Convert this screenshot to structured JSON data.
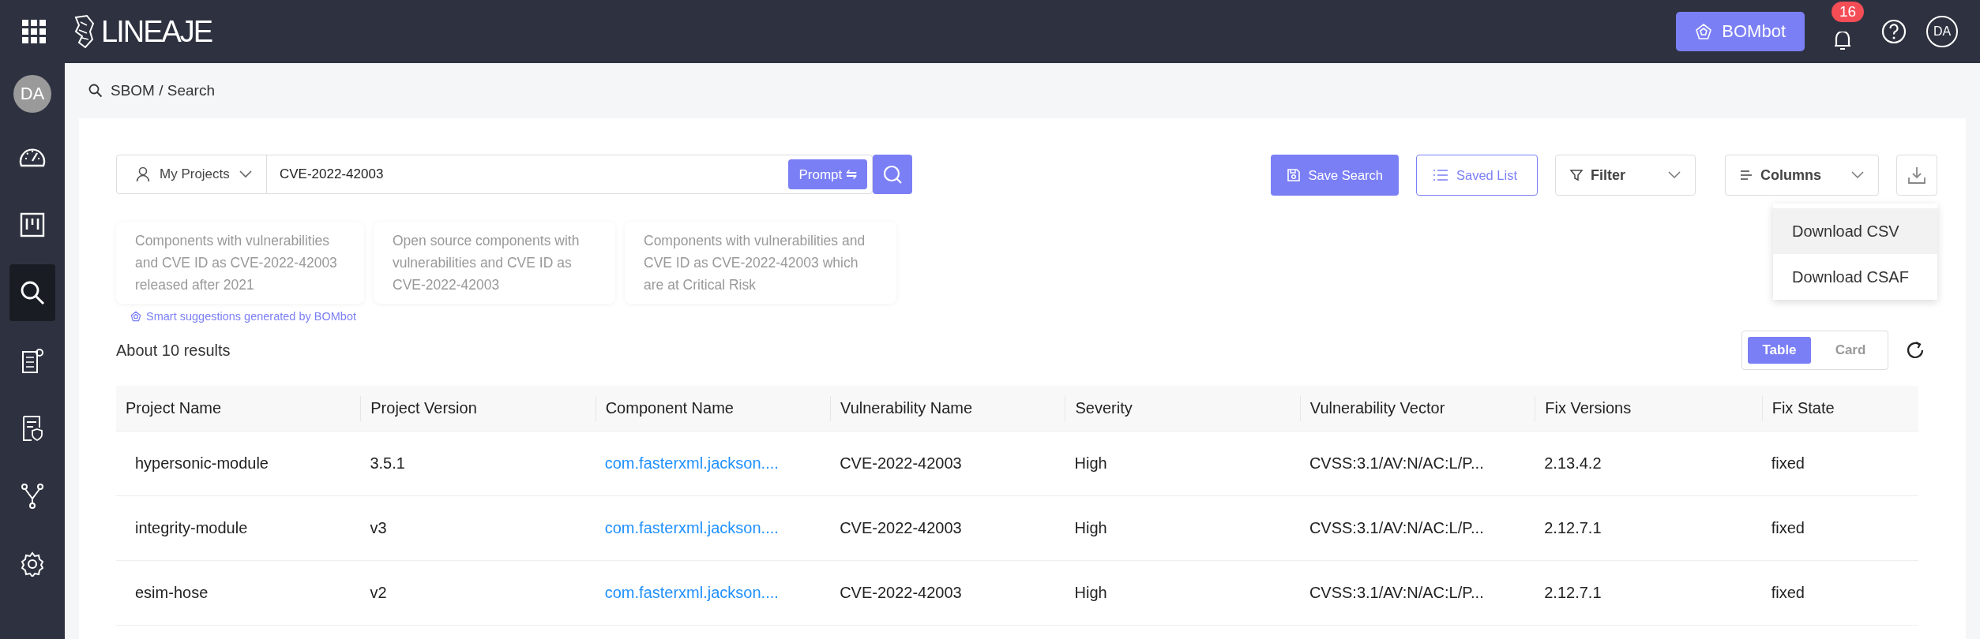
{
  "top_bar": {
    "logo": "LINEAJE",
    "bombot_button": "BOMbot",
    "notification_count": "16",
    "user_initials": "DA"
  },
  "sidebar": {
    "user_initials": "DA",
    "items": [
      {
        "kind": "dashboard",
        "selected": false
      },
      {
        "kind": "board",
        "selected": false
      },
      {
        "kind": "search",
        "selected": true
      },
      {
        "kind": "document",
        "selected": false
      },
      {
        "kind": "policy",
        "selected": false
      },
      {
        "kind": "branch",
        "selected": false
      },
      {
        "kind": "settings",
        "selected": false
      }
    ]
  },
  "breadcrumb": "SBOM / Search",
  "search": {
    "scope": "My Projects",
    "value": "CVE-2022-42003",
    "prompt_button": "Prompt ⇋"
  },
  "suggestions": [
    "Components with vulnerabilities and CVE ID as CVE-2022-42003 released after 2021",
    "Open source components with vulnerabilities and CVE ID as CVE-2022-42003",
    "Components with vulnerabilities and CVE ID as CVE-2022-42003 which are at Critical Risk"
  ],
  "suggestions_note": "Smart suggestions generated by BOMbot",
  "toolbar": {
    "save_search": "Save Search",
    "saved_list": "Saved List",
    "filter": "Filter",
    "columns": "Columns"
  },
  "download_menu": [
    {
      "label": "Download CSV",
      "highlighted": true
    },
    {
      "label": "Download CSAF",
      "highlighted": false
    }
  ],
  "results_count": "About 10 results",
  "view_toggle": [
    {
      "label": "Table",
      "selected": true
    },
    {
      "label": "Card",
      "selected": false
    }
  ],
  "table": {
    "columns": [
      "Project Name",
      "Project Version",
      "Component Name",
      "Vulnerability Name",
      "Severity",
      "Vulnerability Vector",
      "Fix Versions",
      "Fix State"
    ],
    "rows": [
      [
        "hypersonic-module",
        "3.5.1",
        "com.fasterxml.jackson....",
        "CVE-2022-42003",
        "High",
        "CVSS:3.1/AV:N/AC:L/P...",
        "2.13.4.2",
        "fixed"
      ],
      [
        "integrity-module",
        "v3",
        "com.fasterxml.jackson....",
        "CVE-2022-42003",
        "High",
        "CVSS:3.1/AV:N/AC:L/P...",
        "2.12.7.1",
        "fixed"
      ],
      [
        "esim-hose",
        "v2",
        "com.fasterxml.jackson....",
        "CVE-2022-42003",
        "High",
        "CVSS:3.1/AV:N/AC:L/P...",
        "2.12.7.1",
        "fixed"
      ]
    ]
  }
}
